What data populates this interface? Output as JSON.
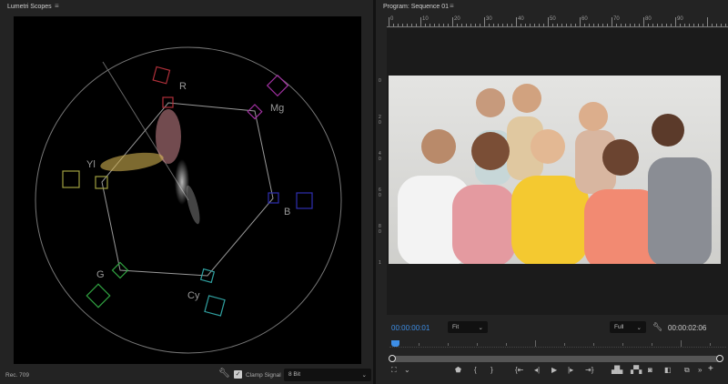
{
  "left_panel": {
    "title": "Lumetri Scopes",
    "standard": "Rec. 709",
    "clamp_signal_label": "Clamp Signal",
    "clamp_signal_checked": true,
    "bit_depth": "8 Bit"
  },
  "vectorscope": {
    "labels": {
      "r": "R",
      "mg": "Mg",
      "b": "B",
      "cy": "Cy",
      "g": "G",
      "yl": "Yl"
    },
    "colors": {
      "r": "#b0303a",
      "mg": "#a030a0",
      "b": "#3030b0",
      "cy": "#30a0a0",
      "g": "#30a040",
      "yl": "#a0a040"
    }
  },
  "program": {
    "title": "Program: Sequence 01",
    "ruler_labels": [
      "0",
      "10",
      "20",
      "30",
      "40",
      "50",
      "60",
      "70",
      "80",
      "90"
    ],
    "vruler_labels": [
      "0",
      "2 0",
      "4 0",
      "6 0",
      "8 0",
      "1"
    ],
    "current_time": "00:00:00:01",
    "zoom": "Fit",
    "resolution": "Full",
    "duration": "00:00:02:06",
    "accent": "#3d8ee6"
  },
  "icons": [
    "menu-icon",
    "wrench-icon",
    "checkbox-icon",
    "chevron-down-icon",
    "safe-margins-icon",
    "marker-icon",
    "mark-in-icon",
    "mark-out-icon",
    "go-to-in-icon",
    "step-back-icon",
    "play-icon",
    "step-forward-icon",
    "go-to-out-icon",
    "lift-icon",
    "extract-icon",
    "camera-icon",
    "compare-icon",
    "overwrite-icon",
    "more-icon",
    "add-icon"
  ]
}
